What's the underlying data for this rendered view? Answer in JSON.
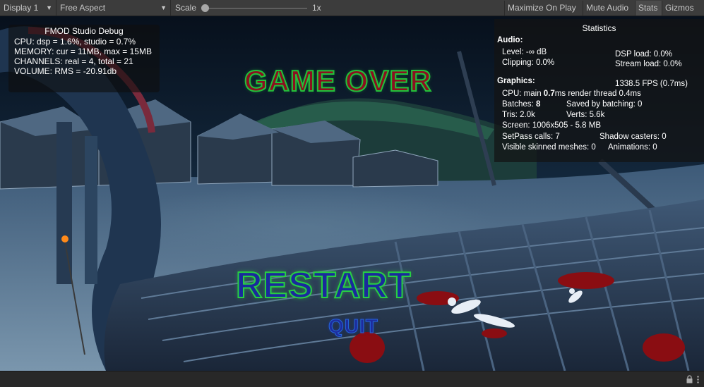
{
  "toolbar": {
    "display": "Display 1",
    "aspect": "Free Aspect",
    "scale_label": "Scale",
    "scale_value": "1x",
    "scale_slider_fraction": 0.0,
    "maximize": "Maximize On Play",
    "mute": "Mute Audio",
    "stats": "Stats",
    "gizmos": "Gizmos"
  },
  "fmod": {
    "title": "FMOD Studio Debug",
    "lines": [
      "CPU: dsp = 1.6%, studio = 0.7%",
      "MEMORY: cur = 11MB, max = 15MB",
      "CHANNELS: real = 4, total = 21",
      "VOLUME: RMS = -20.91db"
    ]
  },
  "stats": {
    "title": "Statistics",
    "audio_header": "Audio:",
    "level": "Level: -∞ dB",
    "dsp_load": "DSP load: 0.0%",
    "clipping": "Clipping: 0.0%",
    "stream_load": "Stream load: 0.0%",
    "graphics_header": "Graphics:",
    "fps": "1338.5 FPS (0.7ms)",
    "cpu_main_prefix": "CPU: main ",
    "cpu_main_value": "0.7",
    "cpu_main_suffix": "ms  render thread 0.4ms",
    "batches_prefix": "Batches: ",
    "batches_value": "8",
    "saved_batching": "Saved by batching: 0",
    "tris": "Tris: 2.0k",
    "verts": "Verts: 5.6k",
    "screen": "Screen: 1006x505 - 5.8 MB",
    "setpass": "SetPass calls: 7",
    "shadow_casters": "Shadow casters: 0",
    "skinned": "Visible skinned meshes: 0",
    "animations": "Animations: 0"
  },
  "game": {
    "title": "GAME OVER",
    "restart": "RESTART",
    "quit": "QUIT"
  },
  "icons": {
    "dropdown": "chevron-down-icon",
    "lock": "lock-icon",
    "menu": "kebab-menu-icon"
  },
  "colors": {
    "editor_bg": "#3c3c3c",
    "title_fill": "#8b1020",
    "title_outline": "#22c23a",
    "restart_fill": "#1a2a9c",
    "quit_fill": "#1d2c9e"
  }
}
